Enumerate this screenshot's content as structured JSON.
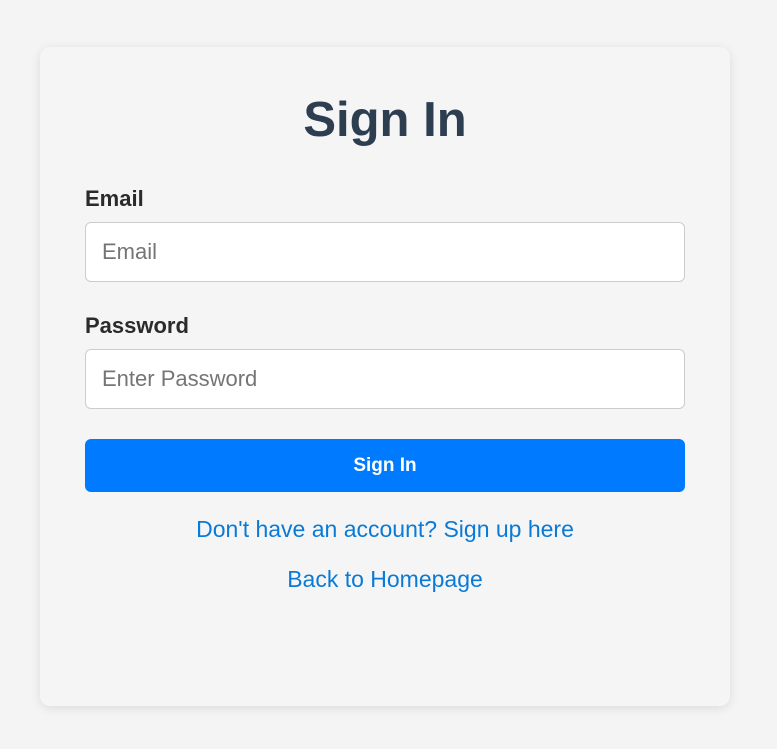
{
  "form": {
    "title": "Sign In",
    "email": {
      "label": "Email",
      "value": "",
      "placeholder": "Email"
    },
    "password": {
      "label": "Password",
      "value": "",
      "placeholder": "Enter Password"
    },
    "submit_label": "Sign In"
  },
  "links": {
    "signup": "Don't have an account? Sign up here",
    "home": "Back to Homepage"
  },
  "colors": {
    "background": "#f4f4f4",
    "title": "#2c3e50",
    "button": "#007bff",
    "link": "#0a7ad6"
  }
}
